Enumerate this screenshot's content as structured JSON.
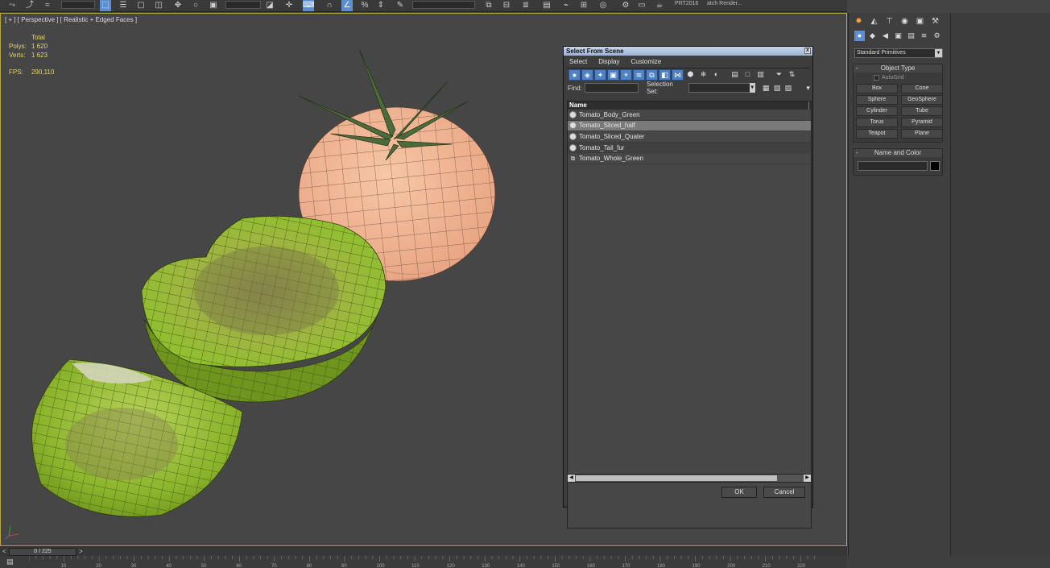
{
  "toolbar": {
    "set_text": "PRT2016",
    "batch_text": "atch Render..."
  },
  "viewport": {
    "label": "[ + ] [ Perspective ] [ Realistic + Edged Faces ]",
    "stats": {
      "total_label": "Total",
      "polys_label": "Polys:",
      "polys_value": "1 620",
      "verts_label": "Verts:",
      "verts_value": "1 623",
      "fps_label": "FPS:",
      "fps_value": "290,110"
    }
  },
  "dialog": {
    "title": "Select From Scene",
    "close": "x",
    "menu": [
      "Select",
      "Display",
      "Customize"
    ],
    "find_label": "Find:",
    "selection_set_label": "Selection Set:",
    "column_name": "Name",
    "items": [
      {
        "name": "Tomato_Body_Green",
        "selected": false,
        "type": "object"
      },
      {
        "name": "Tomato_Sliced_half",
        "selected": true,
        "type": "object"
      },
      {
        "name": "Tomato_Sliced_Quater",
        "selected": false,
        "type": "object"
      },
      {
        "name": "Tomato_Tail_fur",
        "selected": false,
        "type": "object"
      },
      {
        "name": "Tomato_Whole_Green",
        "selected": false,
        "type": "group"
      }
    ],
    "ok": "OK",
    "cancel": "Cancel"
  },
  "command_panel": {
    "category": "Standard Primitives",
    "object_type_title": "Object Type",
    "autogrid_label": "AutoGrid",
    "primitives": [
      "Box",
      "Cone",
      "Sphere",
      "GeoSphere",
      "Cylinder",
      "Tube",
      "Torus",
      "Pyramid",
      "Teapot",
      "Plane"
    ],
    "name_color_title": "Name and Color",
    "color": "#000000"
  },
  "timeline": {
    "frame": "0 / 225",
    "prev": "<",
    "next": ">",
    "ticks": [
      "10",
      "20",
      "30",
      "40",
      "50",
      "60",
      "70",
      "80",
      "90",
      "100",
      "110",
      "120",
      "130",
      "140",
      "150",
      "160",
      "170",
      "180",
      "190",
      "200",
      "210",
      "220"
    ]
  },
  "colors": {
    "accent": "#5b8fd1",
    "viewport_border": "#b8a84a",
    "stats_text": "#e8d66a",
    "tomato_green": "#8fc02e",
    "tomato_peach": "#f3b896"
  }
}
